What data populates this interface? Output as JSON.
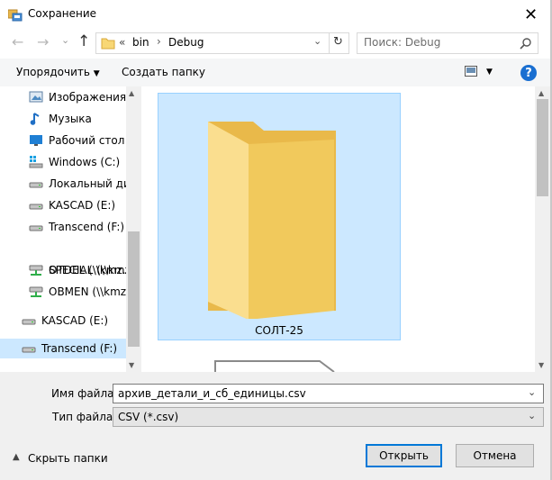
{
  "window": {
    "title": "Сохранение",
    "close_glyph": "✕"
  },
  "nav": {
    "back_glyph": "←",
    "forward_glyph": "→",
    "history_glyph": "⌄",
    "up_glyph": "↑",
    "address": {
      "prefix": "«",
      "crumbs": [
        "bin",
        "Debug"
      ],
      "separator": "›"
    },
    "address_dropdown_glyph": "⌄",
    "refresh_glyph": "↻",
    "search_placeholder": "Поиск: Debug"
  },
  "toolbar": {
    "organize_label": "Упорядочить",
    "organize_arrow": "▼",
    "new_folder_label": "Создать папку",
    "view_arrow": "▼",
    "help_glyph": "?"
  },
  "sidebar": {
    "items": [
      {
        "label": "Изображения",
        "icon": "pictures-icon"
      },
      {
        "label": "Музыка",
        "icon": "music-icon"
      },
      {
        "label": "Рабочий стол",
        "icon": "desktop-icon"
      },
      {
        "label": "Windows (C:)",
        "icon": "windows-drive-icon"
      },
      {
        "label": "Локальный дис",
        "icon": "drive-icon"
      },
      {
        "label": "KASCAD (E:)",
        "icon": "drive-icon"
      },
      {
        "label": "Transcend (F:)",
        "icon": "drive-icon"
      },
      {
        "label": "OTDEL (\\\\kmz.su",
        "icon": "network-drive-icon"
      },
      {
        "label": "SPECIAL (\\\\kmz.",
        "icon": "network-drive-icon"
      },
      {
        "label": "OBMEN (\\\\kmz.s",
        "icon": "network-drive-icon"
      },
      {
        "label": "KASCAD (E:)",
        "icon": "drive-icon"
      },
      {
        "label": "Transcend (F:)",
        "icon": "drive-icon",
        "selected": true
      }
    ],
    "scroll_up_glyph": "▲",
    "scroll_down_glyph": "▼"
  },
  "content": {
    "items": [
      {
        "name": "СОЛТ-25",
        "type": "folder",
        "selected": true
      }
    ],
    "scroll_up_glyph": "▲",
    "scroll_down_glyph": "▼"
  },
  "form": {
    "filename_label": "Имя файла:",
    "filename_value": "архив_детали_и_сб_единицы.csv",
    "filetype_label": "Тип файла:",
    "filetype_value": "CSV (*.csv)",
    "dropdown_glyph": "⌄"
  },
  "footer": {
    "hide_folders_glyph": "▲",
    "hide_folders_label": "Скрыть папки",
    "open_label": "Открыть",
    "cancel_label": "Отмена"
  },
  "colors": {
    "accent": "#0078d7",
    "selection": "#cce8ff",
    "folder": "#f8d775",
    "help": "#1a6fd1"
  }
}
